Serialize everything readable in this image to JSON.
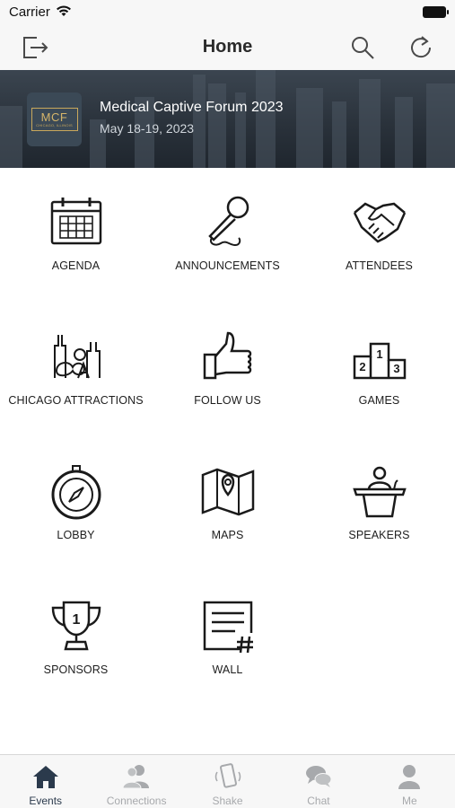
{
  "status": {
    "carrier": "Carrier"
  },
  "nav": {
    "title": "Home"
  },
  "banner": {
    "logo_text": "MCF",
    "logo_sub": "CHICAGO, ILLINOIS",
    "event_title": "Medical Captive Forum 2023",
    "event_date": "May 18-19, 2023"
  },
  "tiles": [
    {
      "label": "AGENDA",
      "icon": "calendar-icon"
    },
    {
      "label": "ANNOUNCEMENTS",
      "icon": "microphone-icon"
    },
    {
      "label": "ATTENDEES",
      "icon": "handshake-icon"
    },
    {
      "label": "CHICAGO ATTRACTIONS",
      "icon": "chicago-skyline-icon"
    },
    {
      "label": "FOLLOW US",
      "icon": "thumbs-up-icon"
    },
    {
      "label": "GAMES",
      "icon": "podium-icon"
    },
    {
      "label": "LOBBY",
      "icon": "compass-icon"
    },
    {
      "label": "MAPS",
      "icon": "map-icon"
    },
    {
      "label": "SPEAKERS",
      "icon": "speaker-podium-icon"
    },
    {
      "label": "SPONSORS",
      "icon": "trophy-icon"
    },
    {
      "label": "WALL",
      "icon": "wall-post-icon"
    }
  ],
  "tabbar": {
    "tabs": [
      {
        "label": "Events",
        "icon": "house-icon",
        "active": true
      },
      {
        "label": "Connections",
        "icon": "people-icon",
        "active": false
      },
      {
        "label": "Shake",
        "icon": "shake-phone-icon",
        "active": false
      },
      {
        "label": "Chat",
        "icon": "chat-bubbles-icon",
        "active": false
      },
      {
        "label": "Me",
        "icon": "person-icon",
        "active": false
      }
    ]
  },
  "colors": {
    "accent": "#2b3a4c",
    "tab_inactive": "#a7a9ac",
    "banner_bg": "#2a323b",
    "logo_gold": "#d5b56a"
  }
}
